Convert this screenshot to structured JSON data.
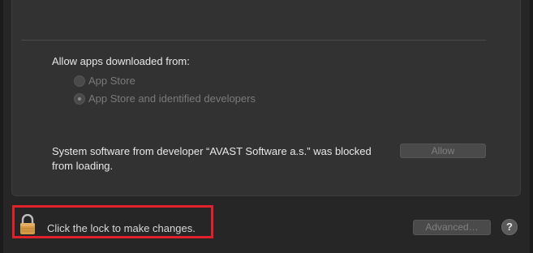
{
  "gatekeeper": {
    "heading": "Allow apps downloaded from:",
    "options": [
      {
        "label": "App Store",
        "selected": false,
        "enabled": false
      },
      {
        "label": "App Store and identified developers",
        "selected": true,
        "enabled": false
      }
    ]
  },
  "blocked_extension": {
    "message": "System software from developer “AVAST Software a.s.” was blocked from loading.",
    "allow_label": "Allow"
  },
  "footer": {
    "lock_label": "Click the lock to make changes.",
    "advanced_label": "Advanced…",
    "help_label": "?"
  },
  "colors": {
    "highlight": "#e0202a",
    "lock_body": "#d49a45"
  },
  "icons": {
    "lock": "lock-icon",
    "help": "help-icon"
  }
}
